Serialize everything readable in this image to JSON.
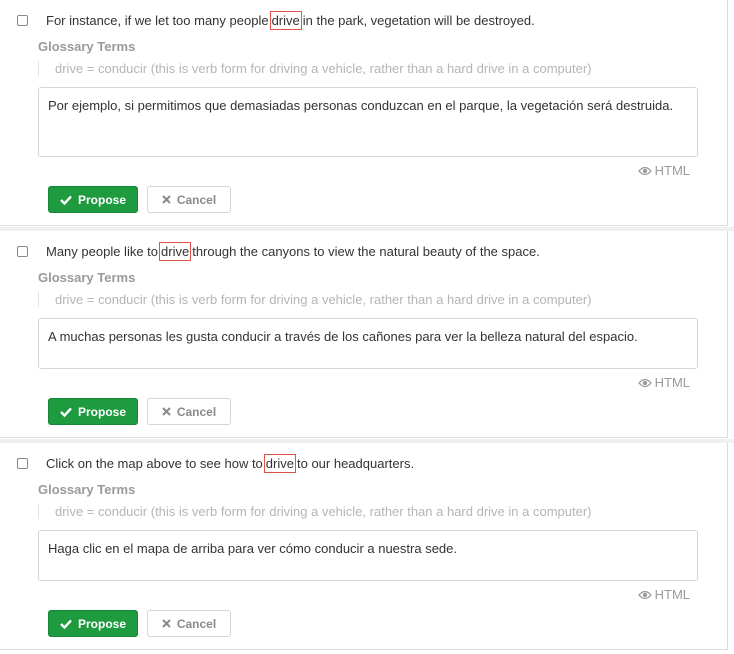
{
  "glossary_heading": "Glossary Terms",
  "html_label": "HTML",
  "propose_label": "Propose",
  "cancel_label": "Cancel",
  "segments": [
    {
      "source_before": "For instance, if we let too many people",
      "term": "drive",
      "source_after": "in the park, vegetation will be destroyed.",
      "glossary_entry": "drive = conducir (this is verb form for driving a vehicle, rather than a hard drive in a computer)",
      "translation": "Por ejemplo, si permitimos que demasiadas personas conduzcan en el parque, la vegetación será destruida."
    },
    {
      "source_before": "Many people like to",
      "term": "drive",
      "source_after": "through the canyons to view the natural beauty of the space.",
      "glossary_entry": "drive = conducir (this is verb form for driving a vehicle, rather than a hard drive in a computer)",
      "translation": "A muchas personas les gusta conducir a través de los cañones para ver la belleza natural del espacio."
    },
    {
      "source_before": "Click on the map above to see how to",
      "term": "drive",
      "source_after": "to our headquarters.",
      "glossary_entry": "drive = conducir (this is verb form for driving a vehicle, rather than a hard drive in a computer)",
      "translation": "Haga clic en el mapa de arriba para ver cómo conducir a nuestra sede."
    }
  ],
  "colors": {
    "propose_bg": "#1e9a3f",
    "term_border": "#e2504c"
  }
}
